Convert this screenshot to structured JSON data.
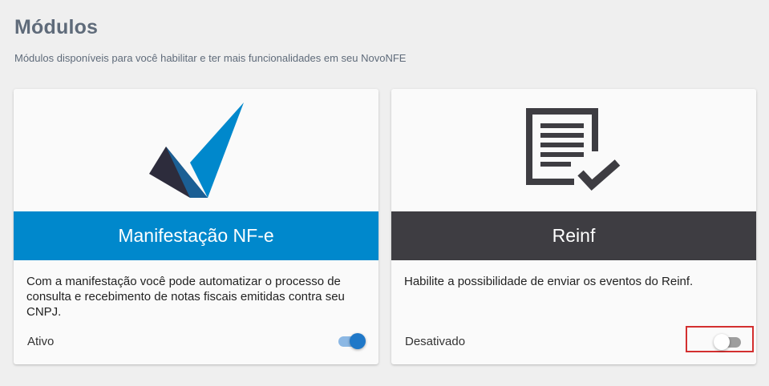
{
  "page": {
    "title": "Módulos",
    "subtitle": "Módulos disponíveis para você habilitar e ter mais funcionalidades em seu NovoNFE"
  },
  "modules": [
    {
      "name": "Manifestação NF-e",
      "description": "Com a manifestação você pode automatizar o processo de consulta e recebimento de notas fiscais emitidas contra seu CNPJ.",
      "status": "Ativo",
      "enabled": true,
      "band_color": "#0088cc",
      "icon": "checkmark-logo-icon"
    },
    {
      "name": "Reinf",
      "description": "Habilite a possibilidade de enviar os eventos do Reinf.",
      "status": "Desativado",
      "enabled": false,
      "band_color": "#3e3d42",
      "icon": "document-check-icon"
    }
  ],
  "colors": {
    "highlight": "#d32f2f",
    "toggle_on": "#1f78c8",
    "toggle_off_track": "#9e9e9e"
  }
}
